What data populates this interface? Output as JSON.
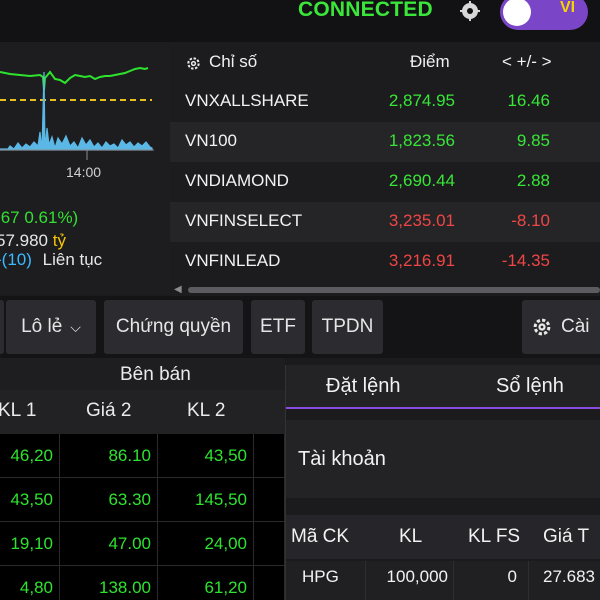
{
  "status": {
    "connection": "CONNECTED",
    "connection_color": "#39e639",
    "icon": "clock-settings-icon",
    "language": "VI"
  },
  "index_chart": {
    "axis_time": "14:00",
    "change": ".67  0.61%)",
    "value": "57.980",
    "value_unit": "tỷ",
    "status_count": "-(10)",
    "status_text": "Liên tục"
  },
  "index_table": {
    "headers": {
      "name": "Chỉ số",
      "points": "Điểm",
      "change": "< +/- >"
    },
    "settings_icon": "gear-icon",
    "rows": [
      {
        "name": "VNXALLSHARE",
        "points": "2,874.95",
        "change": "16.46",
        "trend": "up"
      },
      {
        "name": "VN100",
        "points": "1,823.56",
        "change": "9.85",
        "trend": "up"
      },
      {
        "name": "VNDIAMOND",
        "points": "2,690.44",
        "change": "2.88",
        "trend": "up"
      },
      {
        "name": "VNFINSELECT",
        "points": "3,235.01",
        "change": "-8.10",
        "trend": "down"
      },
      {
        "name": "VNFINLEAD",
        "points": "3,216.91",
        "change": "-14.35",
        "trend": "down"
      }
    ]
  },
  "tabs": {
    "odd_lot": "Lô lẻ",
    "warrants": "Chứng quyền",
    "etf": "ETF",
    "bonds": "TPDN",
    "settings": "Cài"
  },
  "sell_board": {
    "group_label": "Bên bán",
    "headers": [
      "KL 1",
      "Giá 2",
      "KL 2"
    ],
    "rows": [
      [
        "46,20",
        "86.10",
        "43,50"
      ],
      [
        "43,50",
        "63.30",
        "145,50"
      ],
      [
        "19,10",
        "47.00",
        "24,00"
      ],
      [
        "4,80",
        "138.00",
        "61,20"
      ]
    ]
  },
  "order_panel": {
    "tabs": [
      "Đặt lệnh",
      "Sổ lệnh"
    ],
    "account_label": "Tài khoản",
    "positions": {
      "headers": [
        "Mã CK",
        "KL",
        "KL FS",
        "Giá T"
      ],
      "rows": [
        {
          "symbol": "HPG",
          "qty": "100,000",
          "qty_fs": "0",
          "price": "27.683"
        }
      ]
    }
  }
}
